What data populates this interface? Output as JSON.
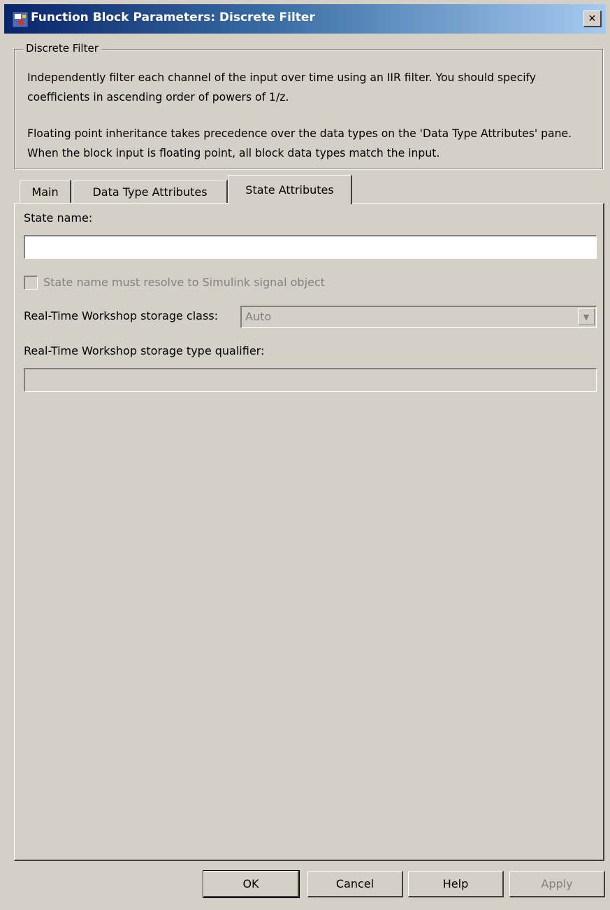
{
  "window": {
    "title": "Function Block Parameters: Discrete Filter",
    "close_symbol": "✕"
  },
  "description": {
    "group_title": "Discrete Filter",
    "paragraph1": "Independently filter each channel of the input over time using an IIR filter. You should specify coefficients in ascending order of powers of 1/z.",
    "paragraph2": "Floating point inheritance takes precedence over the data types on the 'Data Type Attributes' pane. When the block input is floating point, all block data types match the input."
  },
  "tabs": [
    {
      "label": "Main",
      "active": false
    },
    {
      "label": "Data Type Attributes",
      "active": false
    },
    {
      "label": "State Attributes",
      "active": true
    }
  ],
  "state_attributes": {
    "state_name_label": "State name:",
    "state_name_value": "",
    "resolve_checkbox_label": "State name must resolve to Simulink signal object",
    "resolve_checkbox_checked": false,
    "storage_class_label": "Real-Time Workshop storage class:",
    "storage_class_value": "Auto",
    "type_qualifier_label": "Real-Time Workshop storage type qualifier:",
    "type_qualifier_value": ""
  },
  "buttons": {
    "ok": "OK",
    "cancel": "Cancel",
    "help": "Help",
    "apply": "Apply"
  },
  "icons": {
    "app": "simulink-block-icon",
    "close": "close-icon",
    "dropdown": "chevron-down-icon"
  }
}
